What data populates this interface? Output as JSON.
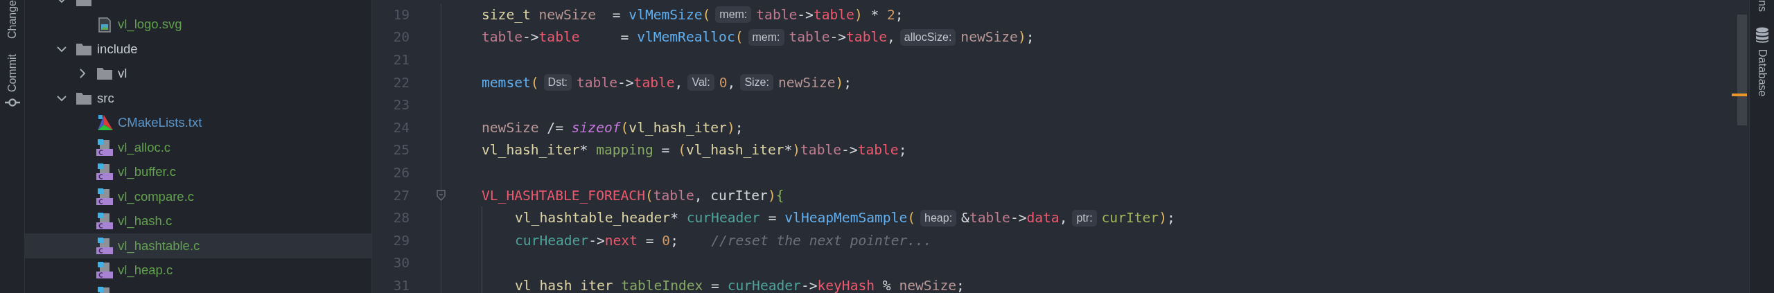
{
  "left_toolbar": [
    {
      "label": "Change",
      "kind": "plain"
    },
    {
      "label": "Commit",
      "kind": "commit"
    }
  ],
  "project_tree": [
    {
      "kind": "folder",
      "expanded": true,
      "selected": false,
      "children": [
        {
          "label": "vl_logo.svg",
          "kind": "image",
          "selected": false,
          "color": "#62a04e"
        }
      ]
    },
    {
      "label": "include",
      "kind": "folder",
      "expanded": true,
      "selected": false,
      "children": [
        {
          "label": "vl",
          "kind": "folder",
          "expanded": false,
          "selected": false
        }
      ]
    },
    {
      "label": "src",
      "kind": "folder",
      "expanded": true,
      "selected": false,
      "children": [
        {
          "label": "CMakeLists.txt",
          "kind": "cmake",
          "selected": false,
          "color": "#5e95c8"
        },
        {
          "label": "vl_alloc.c",
          "kind": "c",
          "selected": false,
          "color": "#62a04e"
        },
        {
          "label": "vl_buffer.c",
          "kind": "c",
          "selected": false,
          "color": "#62a04e"
        },
        {
          "label": "vl_compare.c",
          "kind": "c",
          "selected": false,
          "color": "#62a04e"
        },
        {
          "label": "vl_hash.c",
          "kind": "c",
          "selected": false,
          "color": "#62a04e"
        },
        {
          "label": "vl_hashtable.c",
          "kind": "c",
          "selected": true,
          "color": "#62a04e"
        },
        {
          "label": "vl_heap.c",
          "kind": "c",
          "selected": false,
          "color": "#62a04e"
        },
        {
          "kind": "c",
          "selected": false
        }
      ]
    }
  ],
  "editor": {
    "lines": [
      {
        "number": "19",
        "tokens": [
          {
            "kind": "type",
            "text": "size_t "
          },
          {
            "kind": "local",
            "text": "newSize"
          },
          {
            "kind": "op",
            "text": "  = "
          },
          {
            "kind": "fn",
            "text": "vlMemSize"
          },
          {
            "kind": "paren",
            "text": "("
          },
          {
            "kind": "hint",
            "text": "mem:"
          },
          {
            "kind": "param",
            "text": "table"
          },
          {
            "kind": "op",
            "text": "->"
          },
          {
            "kind": "field",
            "text": "table"
          },
          {
            "kind": "paren",
            "text": ")"
          },
          {
            "kind": "op",
            "text": " * "
          },
          {
            "kind": "num",
            "text": "2"
          },
          {
            "kind": "op",
            "text": ";"
          }
        ]
      },
      {
        "number": "20",
        "tokens": [
          {
            "kind": "param",
            "text": "table"
          },
          {
            "kind": "op",
            "text": "->"
          },
          {
            "kind": "field",
            "text": "table"
          },
          {
            "kind": "op",
            "text": "     = "
          },
          {
            "kind": "fn",
            "text": "vlMemRealloc"
          },
          {
            "kind": "paren",
            "text": "("
          },
          {
            "kind": "hint",
            "text": "mem:"
          },
          {
            "kind": "param",
            "text": "table"
          },
          {
            "kind": "op",
            "text": "->"
          },
          {
            "kind": "field",
            "text": "table"
          },
          {
            "kind": "op",
            "text": ","
          },
          {
            "kind": "hint",
            "text": "allocSize:"
          },
          {
            "kind": "local",
            "text": "newSize"
          },
          {
            "kind": "paren",
            "text": ")"
          },
          {
            "kind": "op",
            "text": ";"
          }
        ]
      },
      {
        "number": "21"
      },
      {
        "number": "22",
        "tokens": [
          {
            "kind": "fn",
            "text": "memset"
          },
          {
            "kind": "paren",
            "text": "("
          },
          {
            "kind": "hint",
            "text": "Dst:"
          },
          {
            "kind": "param",
            "text": "table"
          },
          {
            "kind": "op",
            "text": "->"
          },
          {
            "kind": "field",
            "text": "table"
          },
          {
            "kind": "op",
            "text": ","
          },
          {
            "kind": "hint",
            "text": "Val:"
          },
          {
            "kind": "num",
            "text": "0"
          },
          {
            "kind": "op",
            "text": ","
          },
          {
            "kind": "hint",
            "text": "Size:"
          },
          {
            "kind": "local",
            "text": "newSize"
          },
          {
            "kind": "paren",
            "text": ")"
          },
          {
            "kind": "op",
            "text": ";"
          }
        ]
      },
      {
        "number": "23"
      },
      {
        "number": "24",
        "tokens": [
          {
            "kind": "local",
            "text": "newSize"
          },
          {
            "kind": "op",
            "text": " /= "
          },
          {
            "kind": "keyword",
            "text": "sizeof"
          },
          {
            "kind": "paren",
            "text": "("
          },
          {
            "kind": "type",
            "text": "vl_hash_iter"
          },
          {
            "kind": "paren",
            "text": ")"
          },
          {
            "kind": "op",
            "text": ";"
          }
        ]
      },
      {
        "number": "25",
        "tokens": [
          {
            "kind": "type",
            "text": "vl_hash_iter"
          },
          {
            "kind": "op",
            "text": "* "
          },
          {
            "kind": "green",
            "text": "mapping"
          },
          {
            "kind": "op",
            "text": " = "
          },
          {
            "kind": "paren",
            "text": "("
          },
          {
            "kind": "type",
            "text": "vl_hash_iter"
          },
          {
            "kind": "op",
            "text": "*"
          },
          {
            "kind": "paren",
            "text": ")"
          },
          {
            "kind": "param",
            "text": "table"
          },
          {
            "kind": "op",
            "text": "->"
          },
          {
            "kind": "field",
            "text": "table"
          },
          {
            "kind": "op",
            "text": ";"
          }
        ]
      },
      {
        "number": "26"
      },
      {
        "number": "27",
        "tokens": [
          {
            "kind": "macro",
            "text": "VL_HASHTABLE_FOREACH"
          },
          {
            "kind": "paren",
            "text": "("
          },
          {
            "kind": "param",
            "text": "table"
          },
          {
            "kind": "op",
            "text": ", curIter"
          },
          {
            "kind": "paren",
            "text": ")"
          },
          {
            "kind": "brace",
            "text": "{"
          }
        ],
        "children": [
          {
            "number": "28",
            "tokens": [
              {
                "kind": "type",
                "text": "vl_hashtable_header"
              },
              {
                "kind": "op",
                "text": "* "
              },
              {
                "kind": "teal",
                "text": "curHeader"
              },
              {
                "kind": "op",
                "text": " = "
              },
              {
                "kind": "fn",
                "text": "vlHeapMemSample"
              },
              {
                "kind": "paren",
                "text": "("
              },
              {
                "kind": "hint",
                "text": "heap:"
              },
              {
                "kind": "op",
                "text": "&"
              },
              {
                "kind": "param",
                "text": "table"
              },
              {
                "kind": "op",
                "text": "->"
              },
              {
                "kind": "field",
                "text": "data"
              },
              {
                "kind": "op",
                "text": ","
              },
              {
                "kind": "hint",
                "text": "ptr:"
              },
              {
                "kind": "lime",
                "text": "curIter"
              },
              {
                "kind": "paren",
                "text": ")"
              },
              {
                "kind": "op",
                "text": ";"
              }
            ]
          },
          {
            "number": "29",
            "tokens": [
              {
                "kind": "teal",
                "text": "curHeader"
              },
              {
                "kind": "op",
                "text": "->"
              },
              {
                "kind": "field",
                "text": "next"
              },
              {
                "kind": "op",
                "text": " = "
              },
              {
                "kind": "num",
                "text": "0"
              },
              {
                "kind": "op",
                "text": ";    "
              },
              {
                "kind": "comment",
                "text": "//reset the next pointer..."
              }
            ]
          },
          {
            "number": "30"
          },
          {
            "number": "31",
            "tokens": [
              {
                "kind": "type",
                "text": "vl_hash_iter "
              },
              {
                "kind": "green",
                "text": "tableIndex"
              },
              {
                "kind": "op",
                "text": " = "
              },
              {
                "kind": "teal",
                "text": "curHeader"
              },
              {
                "kind": "op",
                "text": "->"
              },
              {
                "kind": "field",
                "text": "keyHash"
              },
              {
                "kind": "op",
                "text": " % "
              },
              {
                "kind": "local",
                "text": "newSize"
              },
              {
                "kind": "op",
                "text": ";"
              }
            ]
          }
        ]
      }
    ]
  },
  "right_toolbar": [
    {
      "label": "ns",
      "kind": "plain"
    },
    {
      "label": "Database",
      "kind": "database"
    }
  ]
}
